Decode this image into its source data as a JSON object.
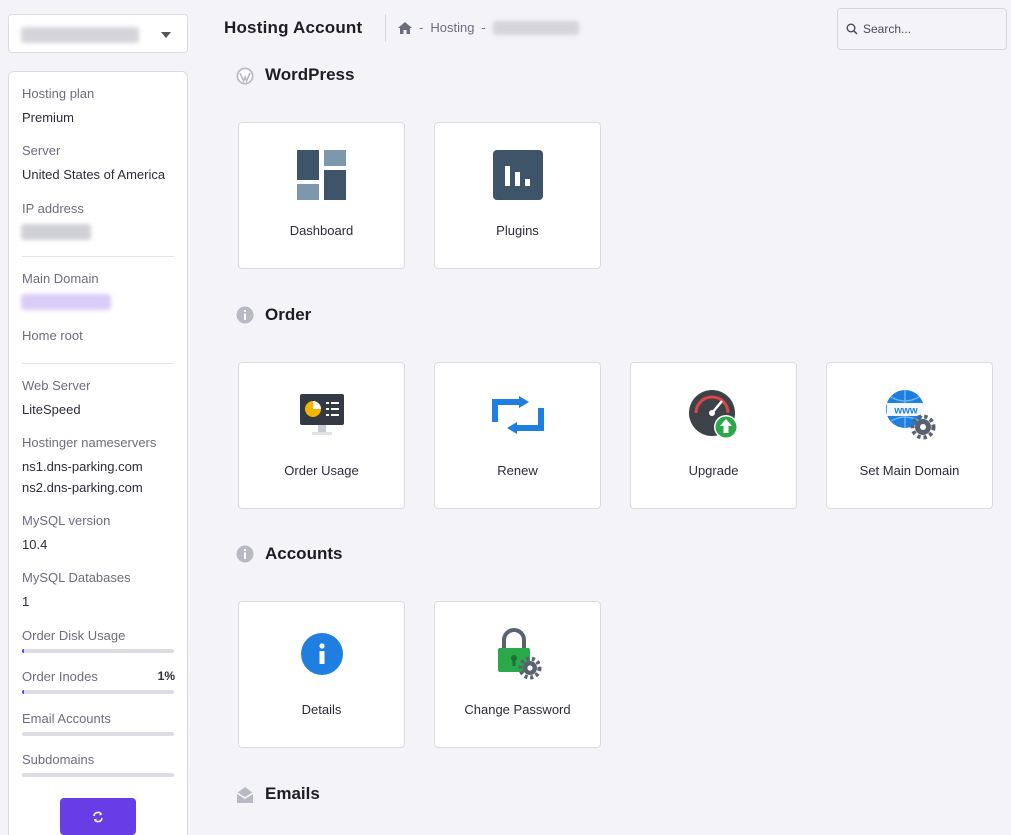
{
  "header": {
    "title": "Hosting Account",
    "breadcrumb": {
      "home_icon": "home-icon",
      "separator": "-",
      "item": "Hosting"
    },
    "search_placeholder": "Search..."
  },
  "sidebar": {
    "hosting_plan_label": "Hosting plan",
    "hosting_plan_value": "Premium",
    "server_label": "Server",
    "server_value": "United States of America",
    "ip_label": "IP address",
    "main_domain_label": "Main Domain",
    "home_root_label": "Home root",
    "web_server_label": "Web Server",
    "web_server_value": "LiteSpeed",
    "nameservers_label": "Hostinger nameservers",
    "ns1": "ns1.dns-parking.com",
    "ns2": "ns2.dns-parking.com",
    "mysql_version_label": "MySQL version",
    "mysql_version_value": "10.4",
    "mysql_db_label": "MySQL Databases",
    "mysql_db_value": "1",
    "disk_usage_label": "Order Disk Usage",
    "disk_usage_fraction": 0.01,
    "inodes_label": "Order Inodes",
    "inodes_percent": "1%",
    "inodes_fraction": 0.01,
    "email_accounts_label": "Email Accounts",
    "email_accounts_fraction": 0,
    "subdomains_label": "Subdomains",
    "subdomains_fraction": 0,
    "refresh_icon": "refresh-icon"
  },
  "sections": {
    "wordpress": {
      "title": "WordPress",
      "icon": "wordpress-icon",
      "cards": [
        {
          "label": "Dashboard",
          "icon": "dashboard-icon"
        },
        {
          "label": "Plugins",
          "icon": "plugins-icon"
        }
      ]
    },
    "order": {
      "title": "Order",
      "icon": "info-icon",
      "cards": [
        {
          "label": "Order Usage",
          "icon": "order-usage-icon"
        },
        {
          "label": "Renew",
          "icon": "renew-icon"
        },
        {
          "label": "Upgrade",
          "icon": "upgrade-icon"
        },
        {
          "label": "Set Main Domain",
          "icon": "set-main-domain-icon"
        }
      ]
    },
    "accounts": {
      "title": "Accounts",
      "icon": "info-icon",
      "cards": [
        {
          "label": "Details",
          "icon": "details-icon"
        },
        {
          "label": "Change Password",
          "icon": "change-password-icon"
        }
      ]
    },
    "emails": {
      "title": "Emails",
      "icon": "envelope-icon"
    }
  },
  "colors": {
    "accent": "#673de6",
    "background": "#f3f3f8",
    "card_border": "#dadce0",
    "icon_slate": "#3e5468"
  }
}
